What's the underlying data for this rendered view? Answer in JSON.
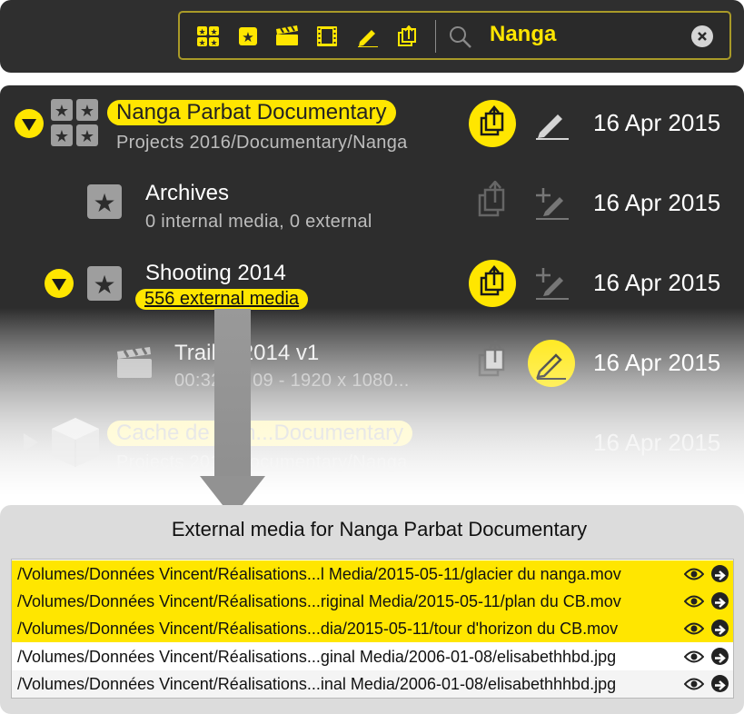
{
  "toolbar": {
    "icons": [
      "grid-stars-icon",
      "star-icon",
      "clapperboard-icon",
      "film-icon",
      "pencil-icon",
      "share-icon",
      "search-icon"
    ],
    "search_value": "Nanga",
    "accent": "#ffe600"
  },
  "list": {
    "items": [
      {
        "title": "Nanga Parbat Documentary",
        "subtitle": "Projects 2016/Documentary/Nanga",
        "date": "16 Apr 2015"
      },
      {
        "title": "Archives",
        "subtitle": "0 internal media, 0 external",
        "date": "16 Apr 2015"
      },
      {
        "title": "Shooting 2014",
        "subtitle": "556 external media",
        "date": "16 Apr 2015"
      },
      {
        "title": "Trailer 2014 v1",
        "subtitle": "00:32:02:09 - 1920 x 1080...",
        "date": "16 Apr 2015"
      },
      {
        "title": "Cache de Nan...Documentary",
        "subtitle": "Projects 2016/Documentary/Nanga",
        "date": "16 Apr 2015"
      }
    ]
  },
  "media_panel": {
    "title": "External media for Nanga Parbat Documentary",
    "rows": [
      {
        "path": "/Volumes/Données Vincent/Réalisations...l Media/2015-05-11/glacier du nanga.mov",
        "highlighted": true
      },
      {
        "path": "/Volumes/Données Vincent/Réalisations...riginal Media/2015-05-11/plan du CB.mov",
        "highlighted": true
      },
      {
        "path": "/Volumes/Données Vincent/Réalisations...dia/2015-05-11/tour d'horizon du CB.mov",
        "highlighted": true
      },
      {
        "path": "/Volumes/Données Vincent/Réalisations...ginal Media/2006-01-08/elisabethhbd.jpg",
        "highlighted": false
      },
      {
        "path": "/Volumes/Données Vincent/Réalisations...inal Media/2006-01-08/elisabethhhbd.jpg",
        "highlighted": false
      }
    ]
  }
}
